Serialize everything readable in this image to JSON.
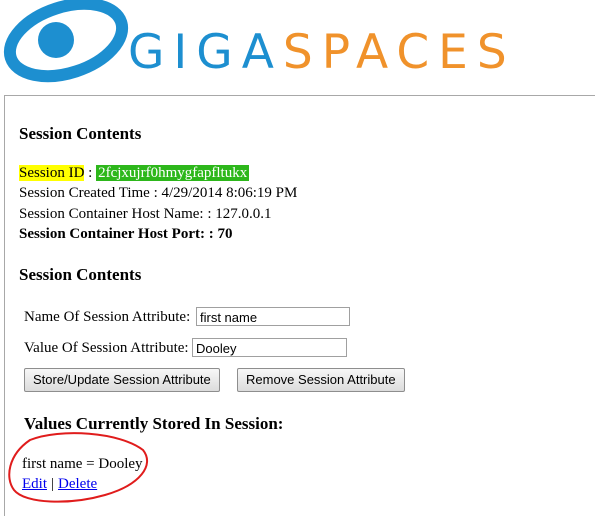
{
  "header": {
    "logo_giga": "GIGA",
    "logo_spaces": "SPACES",
    "brand_blue": "#1d8fd0",
    "brand_orange": "#f0922b"
  },
  "session": {
    "title": "Session Contents",
    "id_label": "Session ID",
    "id_sep": " : ",
    "id_value": "2fcjxujrf0hmygfapfltukx",
    "created_line": "Session Created Time : 4/29/2014 8:06:19 PM",
    "host_line": "Session Container Host Name: : 127.0.0.1",
    "port_line": "Session Container Host Port: : 70"
  },
  "form": {
    "title": "Session Contents",
    "name_label": "Name Of Session Attribute:",
    "name_value": "first name",
    "value_label": "Value Of Session Attribute:",
    "value_value": "Dooley",
    "store_button": "Store/Update Session Attribute",
    "remove_button": "Remove Session Attribute"
  },
  "stored": {
    "title": "Values Currently Stored In Session:",
    "entry": "first name = Dooley",
    "edit_link": "Edit",
    "separator": "|",
    "delete_link": "Delete"
  },
  "colors": {
    "highlight_yellow": "#ffff00",
    "highlight_green": "#2db71b",
    "annotation_red": "#e01c1c"
  }
}
